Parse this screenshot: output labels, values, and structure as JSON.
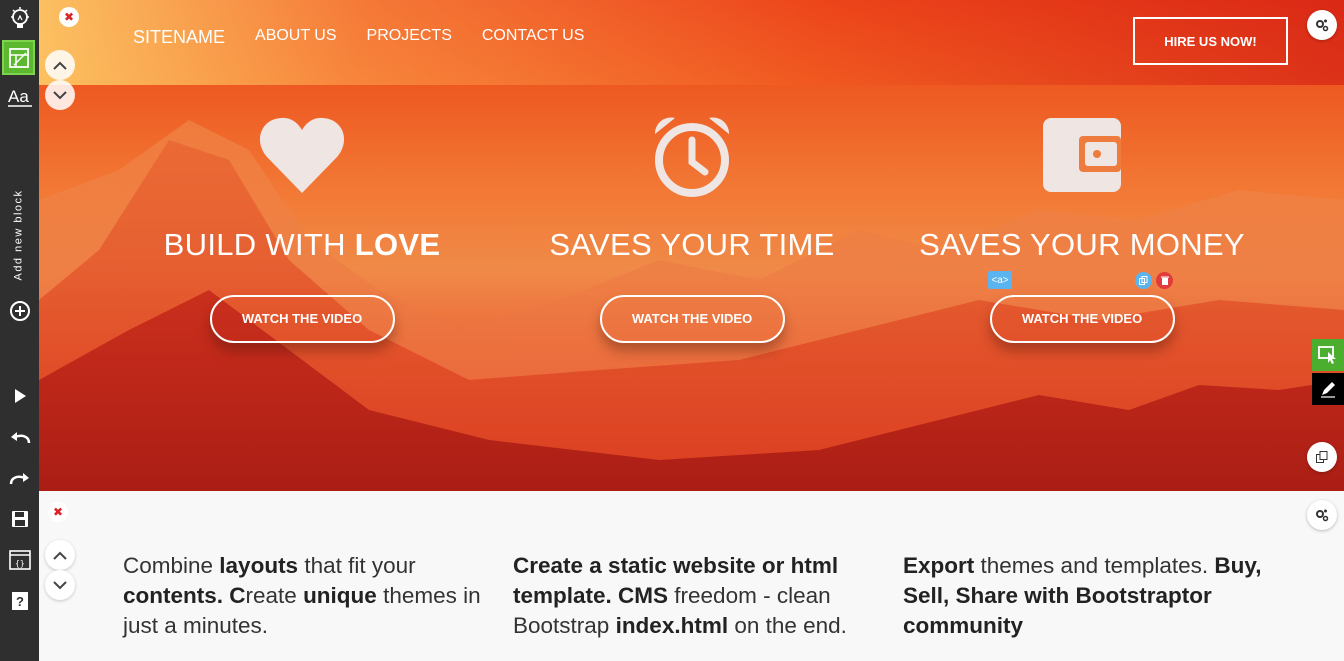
{
  "toolbar": {
    "add_block_label": "Add new block",
    "items": [
      "lightbulb-icon",
      "layout-icon",
      "typography-icon",
      "plus-circle-icon",
      "play-icon",
      "undo-icon",
      "redo-icon",
      "save-icon",
      "code-icon",
      "help-icon"
    ]
  },
  "nav": {
    "brand": "SITENAME",
    "links": [
      "ABOUT US",
      "PROJECTS",
      "CONTACT US"
    ],
    "cta": "HIRE US NOW!"
  },
  "features": [
    {
      "title_prefix": "BUILD WITH ",
      "title_bold": "LOVE",
      "button": "WATCH THE VIDEO",
      "icon": "heart-icon"
    },
    {
      "title_prefix": "SAVES YOUR TIME",
      "title_bold": "",
      "button": "WATCH THE VIDEO",
      "icon": "alarm-clock-icon"
    },
    {
      "title_prefix": "SAVES YOUR MONEY",
      "title_bold": "",
      "button": "WATCH THE VIDEO",
      "icon": "wallet-icon"
    }
  ],
  "editor": {
    "element_tag": "<a>",
    "close_symbol": "✖"
  },
  "lower_columns": [
    [
      {
        "t": "Combine ",
        "b": false
      },
      {
        "t": "layouts",
        "b": true
      },
      {
        "t": " that fit your ",
        "b": false
      },
      {
        "t": "contents. C",
        "b": true
      },
      {
        "t": "reate ",
        "b": false
      },
      {
        "t": "unique",
        "b": true
      },
      {
        "t": " themes in just a minutes.",
        "b": false
      }
    ],
    [
      {
        "t": "Create a static website or html template. CMS",
        "b": true
      },
      {
        "t": " freedom - clean Bootstrap ",
        "b": false
      },
      {
        "t": "index.html",
        "b": true
      },
      {
        "t": " on the end.",
        "b": false
      }
    ],
    [
      {
        "t": "Export",
        "b": true
      },
      {
        "t": "  themes and templates. ",
        "b": false
      },
      {
        "t": "Buy, Sell, Share  with Bootstraptor community",
        "b": true
      }
    ]
  ],
  "colors": {
    "toolbar_bg": "#2f2f2f",
    "toolbar_active": "#5cb82e",
    "hero_accent": "#ee5a22",
    "right_select_tool": "#4cae2e",
    "right_edit_tool": "#000000"
  }
}
